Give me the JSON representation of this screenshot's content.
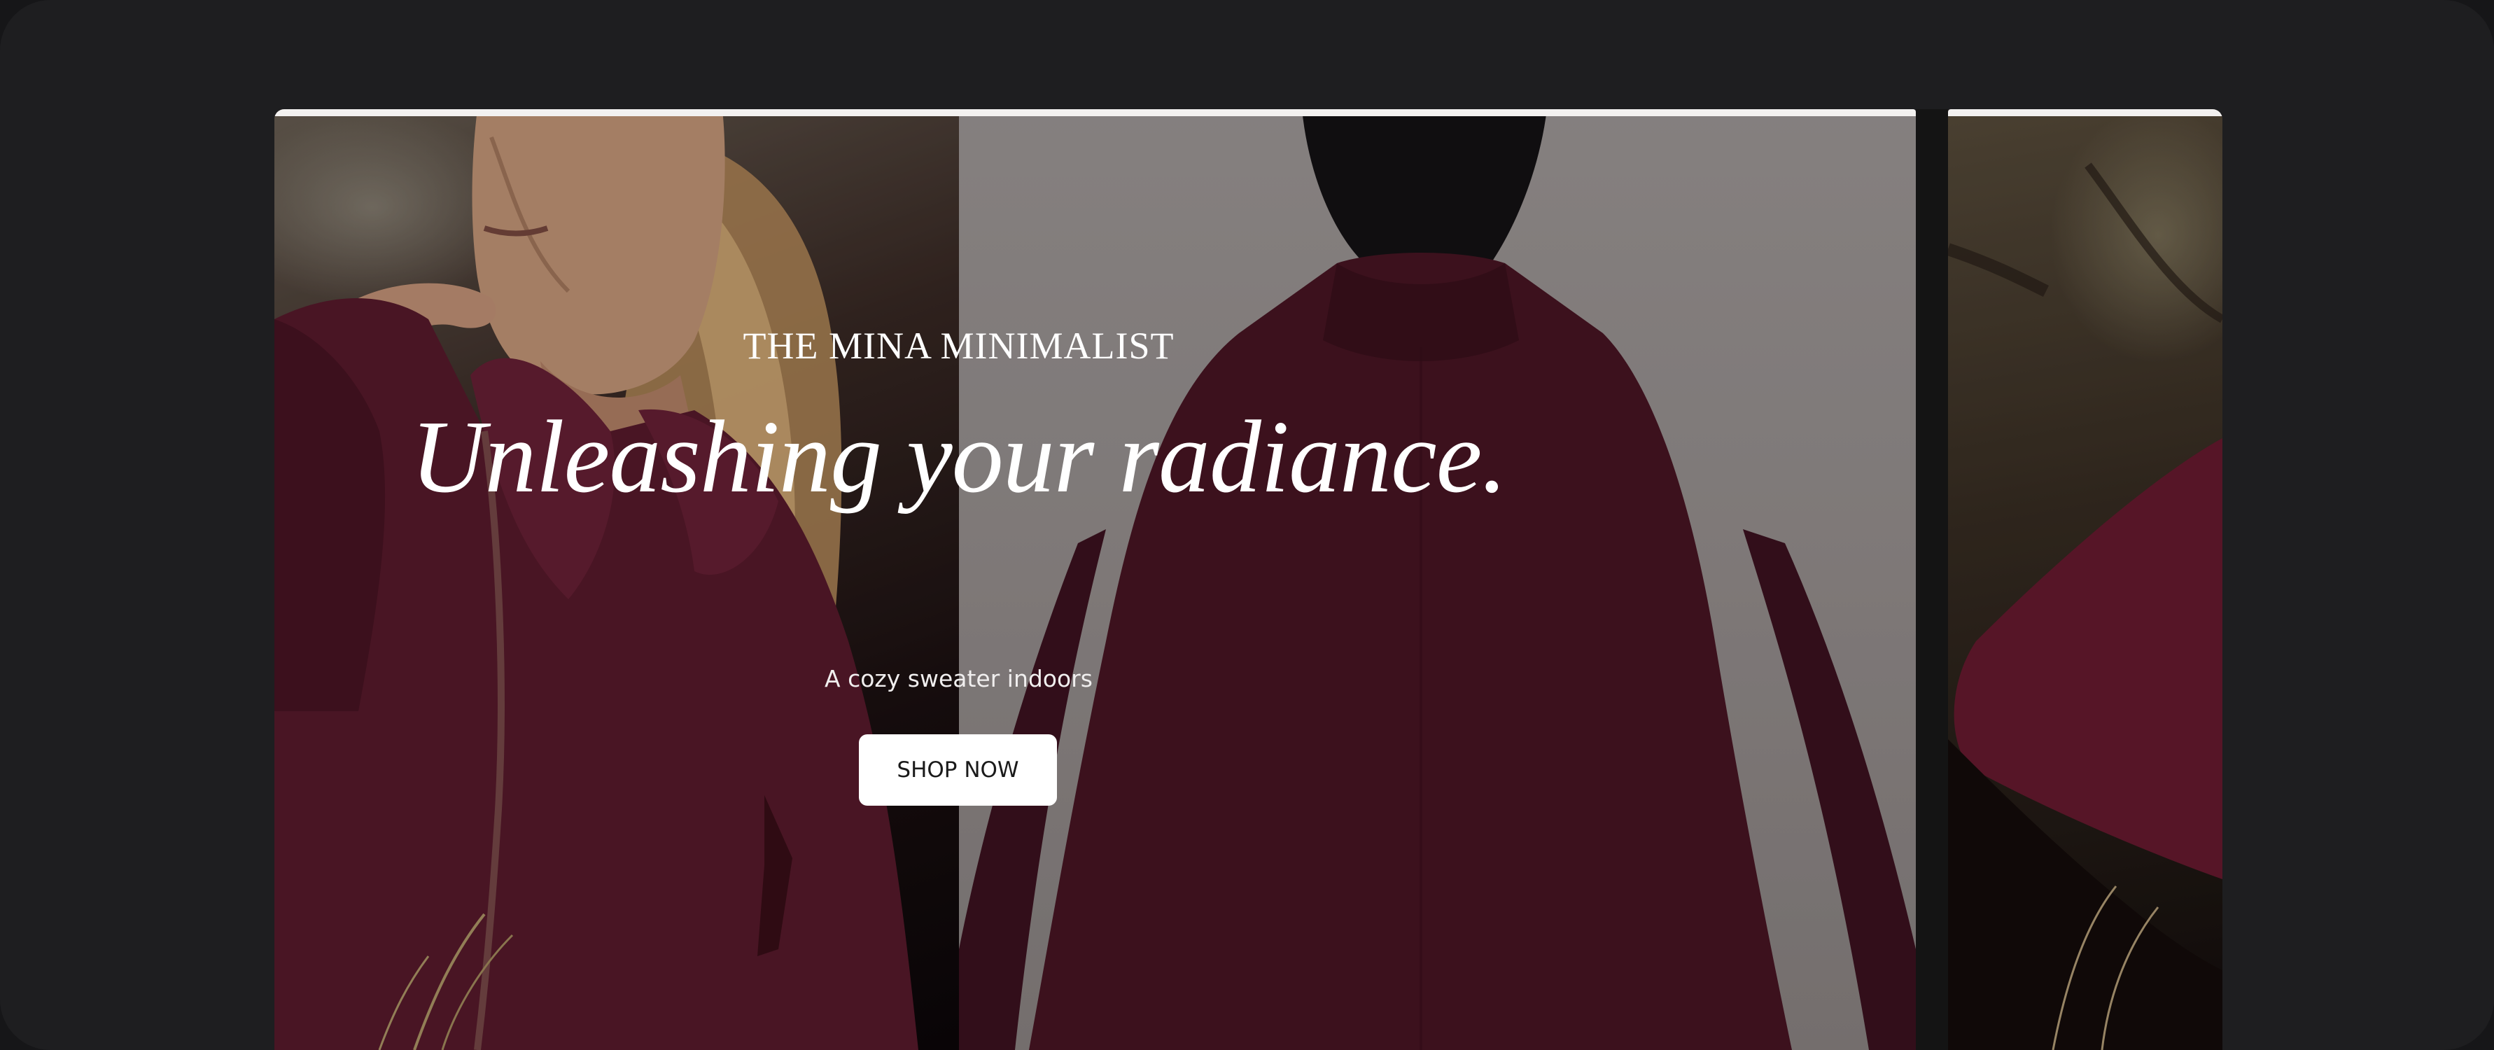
{
  "hero": {
    "brand": "THE MINA MINIMALIST",
    "headline": "Unleashing your radiance.",
    "subtext": "A cozy sweater indoors",
    "cta_label": "SHOP NOW"
  },
  "colors": {
    "background": "#1e1e20",
    "sweater": "#5a1a2c",
    "button_bg": "#ffffff",
    "text": "#ffffff"
  },
  "icons": {
    "left_photo": "woman-in-burgundy-sweater-photo",
    "right_photo": "model-back-view-photo",
    "peek_photo": "next-slide-photo"
  }
}
